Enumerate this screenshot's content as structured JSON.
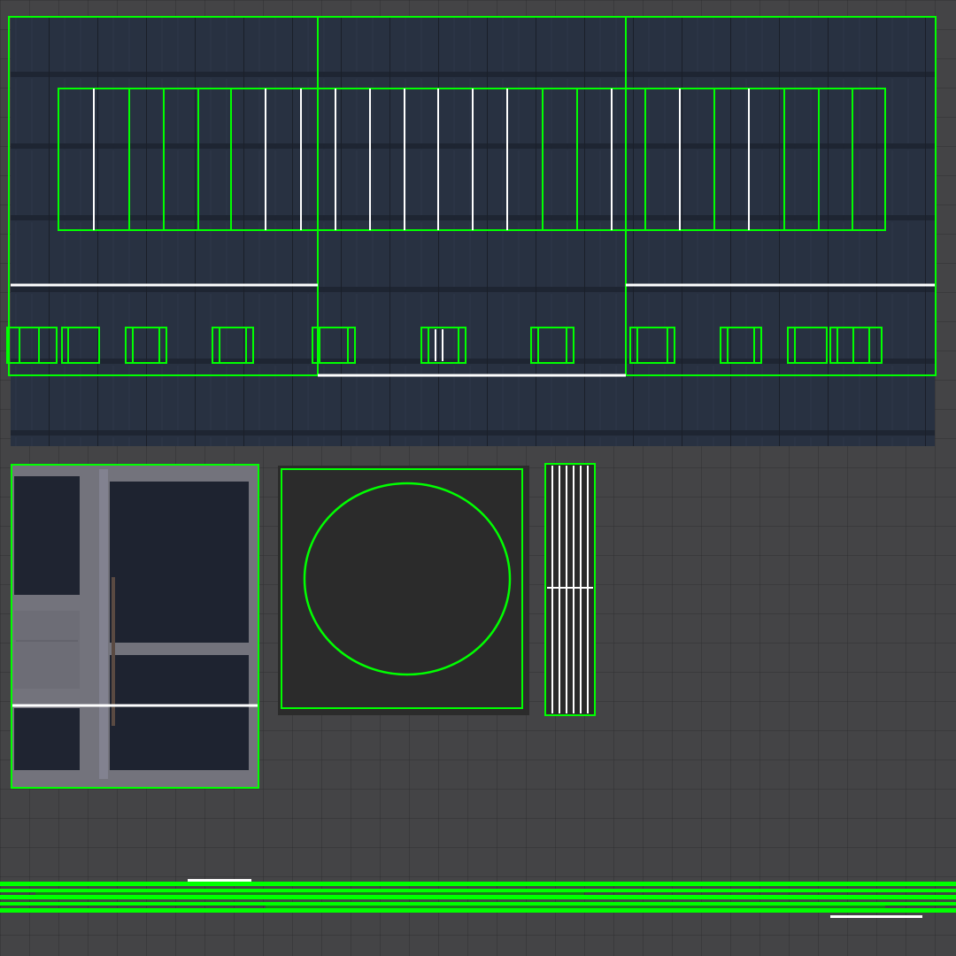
{
  "colors": {
    "background": "#444446",
    "grid_line": "#2f2f31",
    "uv_edge_selected": "#00ff00",
    "uv_edge_seam": "#ffffff",
    "facade_texture": "#283141",
    "door_glass": "#1e2330",
    "door_frame": "#7b7b84",
    "vent_panel": "#2b2b2b"
  },
  "icons": [
    "uv-island-shell",
    "circle-vent-icon",
    "door-handle-icon"
  ]
}
